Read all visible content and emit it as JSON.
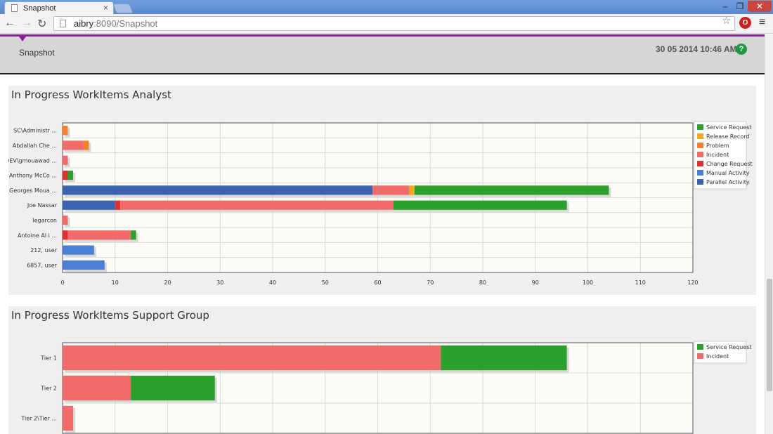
{
  "browser": {
    "tab_title": "Snapshot",
    "tab_close": "×",
    "url_host": "aibry",
    "url_rest": ":8090/Snapshot",
    "back": "←",
    "forward": "→",
    "reload": "↻",
    "star": "☆",
    "extension": "O",
    "menu": "≡",
    "minimize": "–",
    "maximize": "❐",
    "close": "✕"
  },
  "header": {
    "title": "Snapshot",
    "datetime": "30 05 2014 10:46 AM",
    "help": "?",
    "accent": "#8a1d9a"
  },
  "colors": {
    "Service Request": "#2ca02c",
    "Release Record": "#f5a623",
    "Problem": "#f58231",
    "Incident": "#f26b6b",
    "Change Request": "#e03030",
    "Manual Activity": "#4a7fd6",
    "Parallel Activity": "#3a64b0"
  },
  "chart_data": [
    {
      "type": "bar",
      "orientation": "horizontal",
      "stacked": true,
      "title": "In Progress WorkItems Analyst",
      "categories": [
        "SC\\Administr ...",
        "Abdallah Che ...",
        "DEV\\gmouawad ...",
        "Anthony McCo ...",
        "Georges Moua ...",
        "Joe Nassar",
        "legarcon",
        "Antoine Al i ...",
        "212, user",
        "6857, user"
      ],
      "series": [
        {
          "name": "Parallel Activity",
          "values": [
            0,
            0,
            0,
            0,
            59,
            10,
            0,
            0,
            0,
            0
          ]
        },
        {
          "name": "Manual Activity",
          "values": [
            0,
            0,
            0,
            0,
            0,
            0,
            0,
            0,
            6,
            8
          ]
        },
        {
          "name": "Change Request",
          "values": [
            0,
            0,
            0,
            1,
            0,
            1,
            0,
            1,
            0,
            0
          ]
        },
        {
          "name": "Incident",
          "values": [
            0,
            4,
            1,
            0,
            7,
            52,
            1,
            12,
            0,
            0
          ]
        },
        {
          "name": "Problem",
          "values": [
            1,
            1,
            0,
            0,
            0,
            0,
            0,
            0,
            0,
            0
          ]
        },
        {
          "name": "Release Record",
          "values": [
            0,
            0,
            0,
            0,
            1,
            0,
            0,
            0,
            0,
            0
          ]
        },
        {
          "name": "Service Request",
          "values": [
            0,
            0,
            0,
            1,
            37,
            33,
            0,
            1,
            0,
            0
          ]
        }
      ],
      "legend": [
        "Service Request",
        "Release Record",
        "Problem",
        "Incident",
        "Change Request",
        "Manual Activity",
        "Parallel Activity"
      ],
      "xlim": [
        0,
        120
      ],
      "xticks": [
        0,
        10,
        20,
        30,
        40,
        50,
        60,
        70,
        80,
        90,
        100,
        110,
        120
      ],
      "grid": true,
      "legend_position": "right"
    },
    {
      "type": "bar",
      "orientation": "horizontal",
      "stacked": true,
      "title": "In Progress WorkItems Support Group",
      "categories": [
        "Tier 1",
        "Tier 2",
        "Tier 2\\Tier ..."
      ],
      "series": [
        {
          "name": "Incident",
          "values": [
            72,
            13,
            2
          ]
        },
        {
          "name": "Service Request",
          "values": [
            24,
            16,
            0
          ]
        }
      ],
      "legend": [
        "Service Request",
        "Incident"
      ],
      "xlim": [
        0,
        120
      ],
      "grid": true,
      "legend_position": "right"
    }
  ]
}
